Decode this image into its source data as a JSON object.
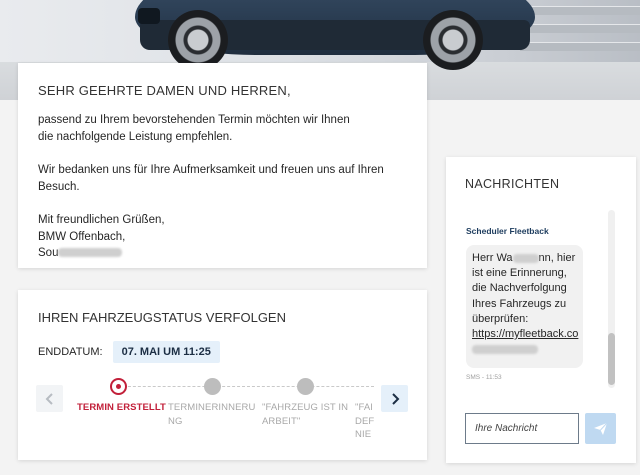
{
  "letter": {
    "salutation": "SEHR GEEHRTE DAMEN UND HERREN,",
    "paragraph1": "passend zu Ihrem bevorstehenden Termin möchten wir Ihnen die nachfolgende Leistung empfehlen.",
    "paragraph2": "Wir bedanken uns für Ihre Aufmerksamkeit und freuen uns auf Ihren Besuch.",
    "closing": "Mit freundlichen Grüßen,",
    "dealer": "BMW Offenbach,",
    "signature_visible": "Sou"
  },
  "status": {
    "title": "IHREN FAHRZEUGSTATUS VERFOLGEN",
    "end_label": "ENDDATUM:",
    "end_value": "07. MAI UM 11:25",
    "steps": [
      {
        "label": "TERMIN ERSTELLT",
        "state": "active"
      },
      {
        "label": "TERMINERINNERU NG",
        "state": "todo"
      },
      {
        "label": "\"FAHRZEUG IST IN ARBEIT\"",
        "state": "todo"
      },
      {
        "label": "\"FAI DEF NIE",
        "state": "todo"
      }
    ],
    "prev_icon": "chevron-left-icon",
    "next_icon": "chevron-right-icon"
  },
  "messages": {
    "title": "NACHRICHTEN",
    "sender": "Scheduler Fleetback",
    "bubble_line1": "Herr Wa",
    "bubble_line1_end": "nn, hier",
    "bubble_line2": "ist eine Erinnerung,",
    "bubble_line3": "die Nachverfolgung",
    "bubble_line4": "Ihres Fahrzeugs zu",
    "bubble_line5": "überprüfen:",
    "bubble_link": "https://myfleetback.co",
    "meta": "SMS - 11:53",
    "input_placeholder": "Ihre Nachricht",
    "send_icon": "paper-plane-icon"
  },
  "colors": {
    "accent_red": "#c2203a",
    "light_blue": "#e5f0fa",
    "navy": "#1c2e44",
    "send_button": "#bfd9f1"
  }
}
